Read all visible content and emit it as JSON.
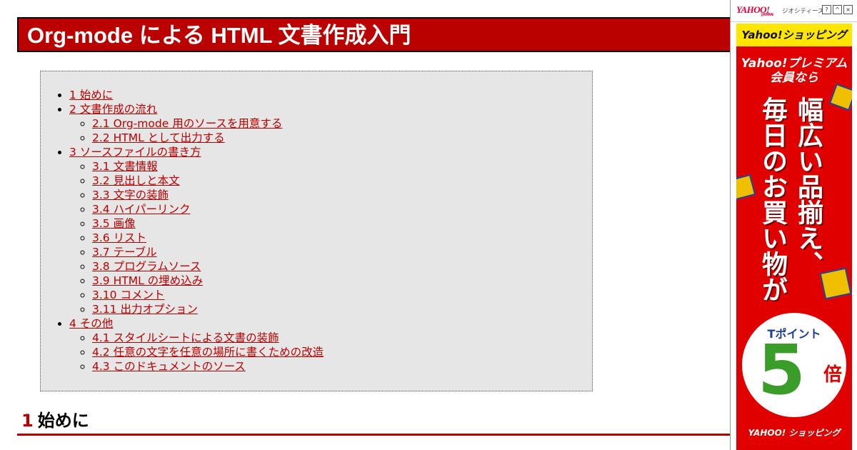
{
  "page": {
    "title": "Org-mode による HTML 文書作成入門"
  },
  "toc": [
    {
      "label": "1 始めに",
      "children": []
    },
    {
      "label": "2 文書作成の流れ",
      "children": [
        "2.1 Org-mode 用のソースを用意する",
        "2.2 HTML として出力する"
      ]
    },
    {
      "label": "3 ソースファイルの書き方",
      "children": [
        "3.1 文書情報",
        "3.2 見出しと本文",
        "3.3 文字の装飾",
        "3.4 ハイパーリンク",
        "3.5 画像",
        "3.6 リスト",
        "3.7 テーブル",
        "3.8 プログラムソース",
        "3.9 HTML の埋め込み",
        "3.10 コメント",
        "3.11 出力オプション"
      ]
    },
    {
      "label": "4 その他",
      "children": [
        "4.1 スタイルシートによる文書の装飾",
        "4.2 任意の文字を任意の場所に書くための改造",
        "4.3 このドキュメントのソース"
      ]
    }
  ],
  "section": {
    "number": "1",
    "title": "始めに"
  },
  "ad": {
    "brand": "YAHOO!",
    "brand_sub": "JAPAN",
    "service": "ジオシティーズ",
    "buttons": [
      "?",
      "^",
      "×"
    ],
    "shop_bar": "Yahoo!ショッピング",
    "premium_line1": "Yahoo!プレミアム",
    "premium_line2": "会員なら",
    "vertical_line1": "幅広い品揃え、",
    "vertical_line2": "毎日のお買い物が",
    "badge_title": "Tポイント",
    "badge_number": "5",
    "badge_unit": "倍",
    "footer": "YAHOO! ショッピング",
    "colors": {
      "red": "#e00000",
      "yellow": "#ffe600",
      "blue": "#1a3d9c"
    }
  },
  "colors": {
    "accent": "#bb0000",
    "toc_background": "#e6e6e6"
  }
}
